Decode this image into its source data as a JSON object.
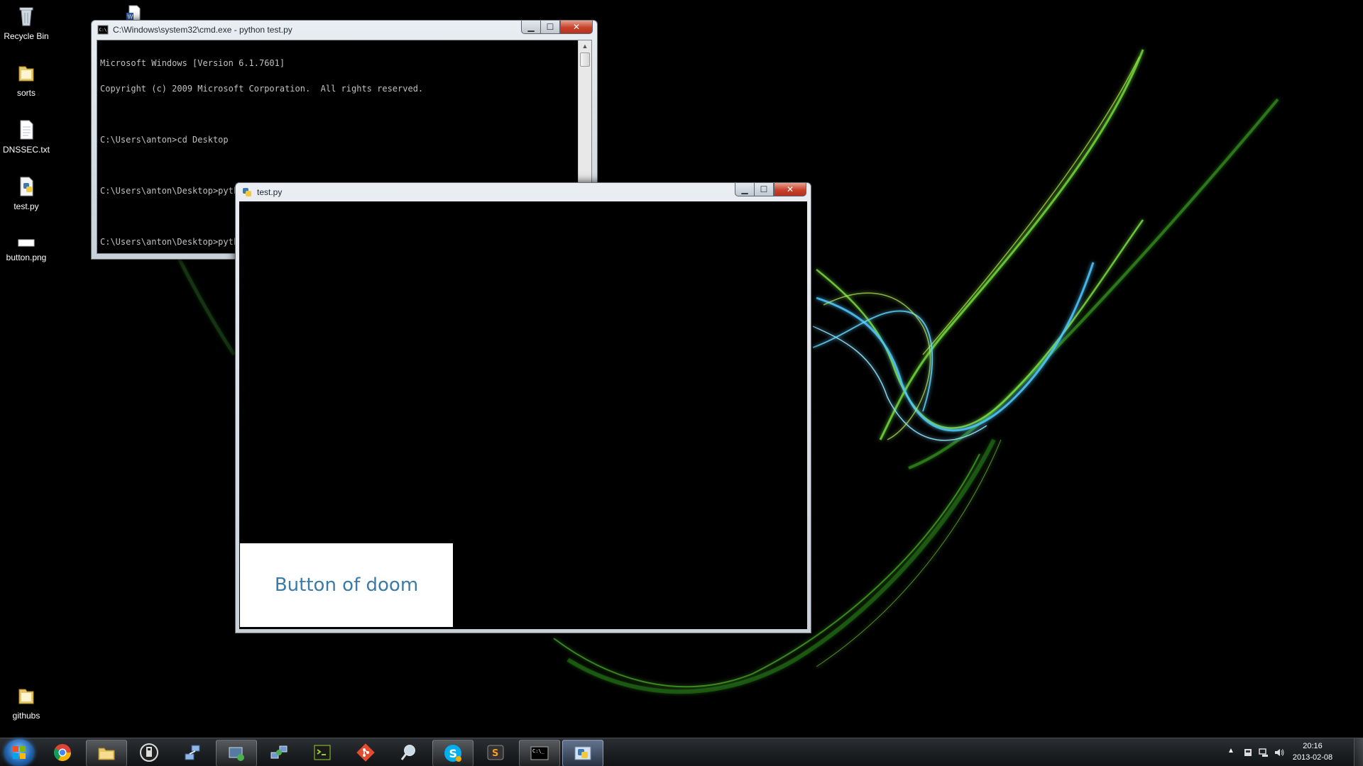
{
  "desktop": {
    "icons": [
      {
        "label": "Recycle Bin",
        "icon": "recycle-bin-icon"
      },
      {
        "label": "sorts",
        "icon": "folder-icon"
      },
      {
        "label": "DNSSEC.txt",
        "icon": "text-file-icon"
      },
      {
        "label": "test.py",
        "icon": "python-file-icon"
      },
      {
        "label": "button.png",
        "icon": "image-file-icon"
      },
      {
        "label": "githubs",
        "icon": "folder-icon"
      }
    ]
  },
  "cmd_window": {
    "title": "C:\\Windows\\system32\\cmd.exe - python  test.py",
    "lines": [
      "Microsoft Windows [Version 6.1.7601]",
      "Copyright (c) 2009 Microsoft Corporation.  All rights reserved.",
      "",
      "C:\\Users\\anton>cd Desktop",
      "",
      "C:\\Users\\anton\\Desktop>python test.py",
      "",
      "C:\\Users\\anton\\Desktop>python test.py"
    ]
  },
  "py_window": {
    "title": "test.py",
    "button_label": "Button of doom"
  },
  "window_controls": {
    "minimize": "▁",
    "maximize": "☐",
    "close": "✕"
  },
  "taskbar": {
    "apps": [
      {
        "name": "chrome-icon",
        "state": "pinned"
      },
      {
        "name": "file-explorer-icon",
        "state": "running"
      },
      {
        "name": "usb-drive-icon",
        "state": "pinned"
      },
      {
        "name": "network-tool-icon",
        "state": "pinned"
      },
      {
        "name": "device-manager-icon",
        "state": "running"
      },
      {
        "name": "network-connections-icon",
        "state": "pinned"
      },
      {
        "name": "terminal-app-icon",
        "state": "pinned"
      },
      {
        "name": "git-icon",
        "state": "pinned"
      },
      {
        "name": "search-tool-icon",
        "state": "pinned"
      },
      {
        "name": "skype-icon",
        "state": "running"
      },
      {
        "name": "sublime-text-icon",
        "state": "pinned"
      },
      {
        "name": "cmd-icon",
        "state": "running"
      },
      {
        "name": "python-icon",
        "state": "active"
      }
    ],
    "tray": {
      "time": "20:16",
      "date": "2013-02-08"
    }
  },
  "colors": {
    "accent_green": "#7fe03a",
    "accent_cyan": "#4fc8ff",
    "button_text": "#3a7ba8"
  }
}
